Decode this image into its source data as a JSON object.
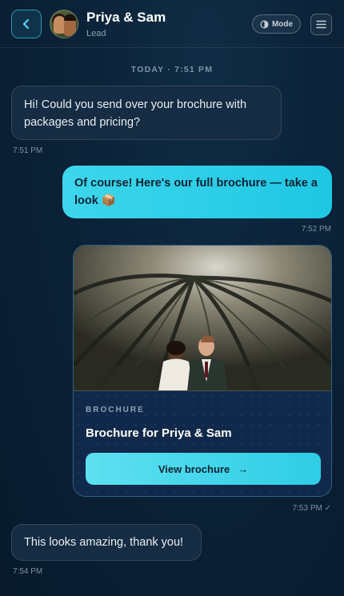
{
  "header": {
    "title": "Priya & Sam",
    "subtitle": "Lead",
    "mode_label": "Mode",
    "accent_color": "#2e97b0"
  },
  "date_separator": "TODAY · 7:51 PM",
  "messages": [
    {
      "direction": "incoming",
      "text": "Hi! Could you send over your brochure with packages and pricing?",
      "time": "7:51 PM"
    },
    {
      "direction": "outgoing",
      "text": "Of course! Here's our full brochure — take a look 📦",
      "time": "7:52 PM"
    },
    {
      "direction": "outgoing",
      "card": {
        "label": "BROCHURE",
        "title": "Brochure for Priya & Sam",
        "button_label": "View brochure",
        "button_icon": "→"
      },
      "time": "7:53 PM ✓"
    },
    {
      "direction": "incoming",
      "text": "This looks amazing, thank you!",
      "time": "7:54 PM"
    }
  ],
  "icons": {
    "back": "chevron-left-icon",
    "mode": "contrast-icon",
    "menu": "hamburger-menu-icon",
    "arrow": "arrow-right-icon"
  }
}
